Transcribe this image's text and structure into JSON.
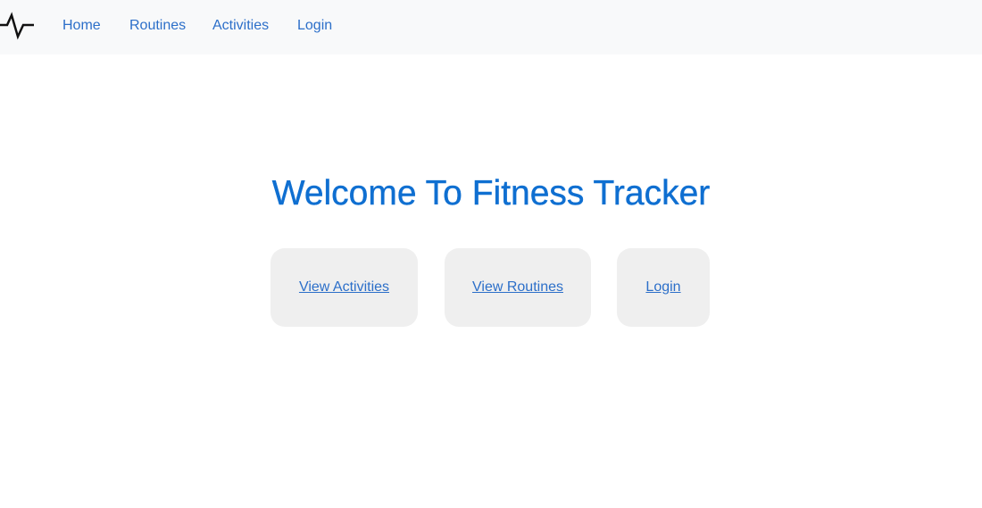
{
  "navbar": {
    "brand_icon": "heartbeat-pulse-icon",
    "items": [
      {
        "label": "Home"
      },
      {
        "label": "Routines"
      },
      {
        "label": "Activities"
      },
      {
        "label": "Login"
      }
    ]
  },
  "main": {
    "title": "Welcome To Fitness Tracker",
    "cards": [
      {
        "link_label": "View Activities"
      },
      {
        "link_label": "View Routines"
      },
      {
        "link_label": "Login"
      }
    ]
  },
  "colors": {
    "navbar_bg": "#f8f9fa",
    "link": "#2c6fc9",
    "title": "#0f6fd1",
    "card_bg": "#efefef"
  }
}
